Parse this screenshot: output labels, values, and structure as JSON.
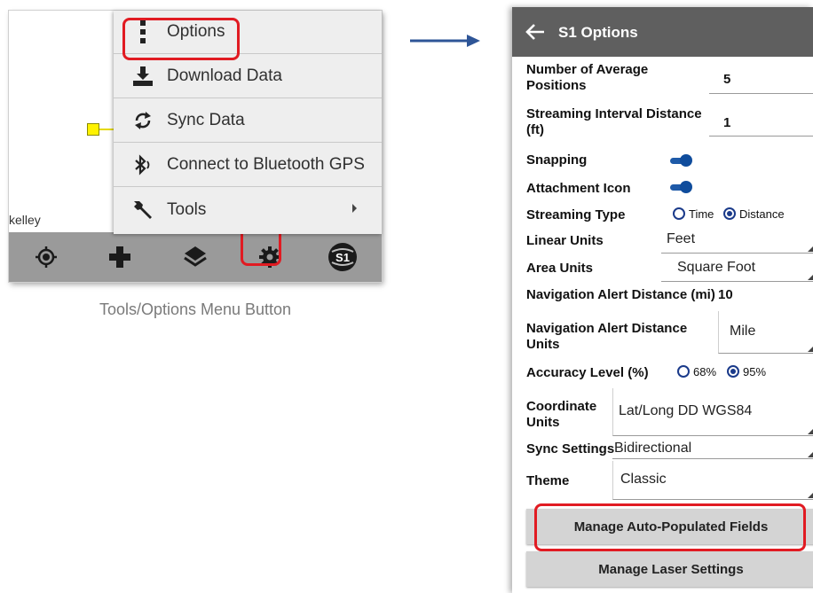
{
  "left_screen": {
    "map_label": "kelley",
    "menu": {
      "items": [
        {
          "label": "Options",
          "icon": "vertical-ellipsis-icon"
        },
        {
          "label": "Download Data",
          "icon": "download-icon"
        },
        {
          "label": "Sync Data",
          "icon": "sync-icon"
        },
        {
          "label": "Connect to Bluetooth GPS",
          "icon": "bluetooth-icon"
        },
        {
          "label": "Tools",
          "icon": "wrench-icon"
        }
      ]
    },
    "toolbar_icons": [
      "locate-icon",
      "plus-icon",
      "layers-icon",
      "gear-icon",
      "s1-logo-icon"
    ]
  },
  "caption": "Tools/Options Menu Button",
  "right_screen": {
    "title": "S1 Options",
    "settings": {
      "avg_positions_label": "Number of Average Positions",
      "avg_positions_value": "5",
      "stream_interval_label": "Streaming Interval Distance (ft)",
      "stream_interval_value": "1",
      "snapping_label": "Snapping",
      "snapping_on": true,
      "attachment_label": "Attachment Icon",
      "attachment_on": true,
      "streaming_type_label": "Streaming Type",
      "streaming_type_options": [
        "Time",
        "Distance"
      ],
      "streaming_type_selected": "Distance",
      "linear_units_label": "Linear Units",
      "linear_units_value": "Feet",
      "area_units_label": "Area Units",
      "area_units_value": "Square Foot",
      "nav_alert_distance_label": "Navigation Alert Distance (mi)",
      "nav_alert_distance_value": "10",
      "nav_alert_units_label": "Navigation Alert Distance Units",
      "nav_alert_units_value": "Mile",
      "accuracy_label": "Accuracy Level (%)",
      "accuracy_options": [
        "68%",
        "95%"
      ],
      "accuracy_selected": "95%",
      "coord_units_label": "Coordinate Units",
      "coord_units_value": "Lat/Long DD WGS84",
      "sync_settings_label": "Sync Settings",
      "sync_settings_value": "Bidirectional",
      "theme_label": "Theme",
      "theme_value": "Classic"
    },
    "buttons": {
      "manage_fields": "Manage Auto-Populated Fields",
      "manage_laser": "Manage Laser Settings"
    }
  },
  "colors": {
    "highlight": "#e11b22",
    "appbar": "#5f5f5f",
    "toggle": "#1e5aa8",
    "arrow": "#2e5597"
  }
}
